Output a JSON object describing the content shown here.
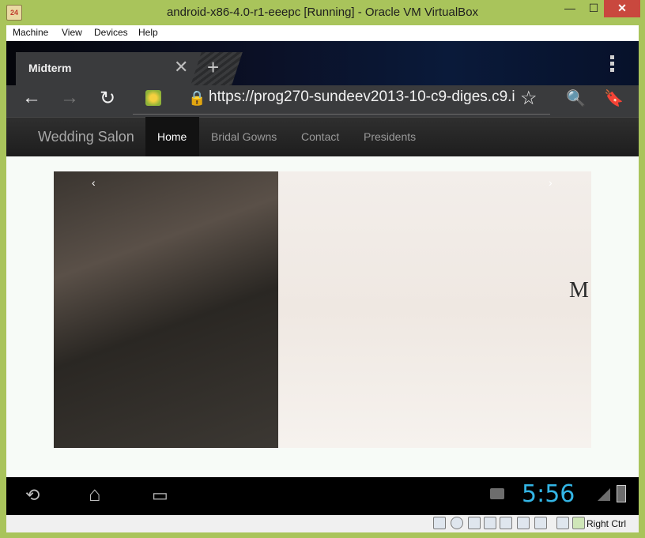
{
  "window": {
    "title": "android-x86-4.0-r1-eeepc [Running] - Oracle VM VirtualBox",
    "app_icon": "virtualbox-icon",
    "controls": {
      "minimize": "—",
      "maximize": "☐",
      "close": "✕"
    }
  },
  "menubar": {
    "items": [
      "Machine",
      "View",
      "Devices",
      "Help"
    ]
  },
  "browser": {
    "tab": {
      "title": "Midterm",
      "close": "✕"
    },
    "new_tab": "+",
    "url": "https://prog270-sundeev2013-10-c9-diges.c9.i",
    "icons": {
      "back": "←",
      "forward": "→",
      "reload": "↻",
      "lock": "🔒",
      "star": "☆",
      "search": "🔍",
      "bookmarks": "🔖"
    }
  },
  "site": {
    "brand": "Wedding Salon",
    "nav": [
      {
        "label": "Home",
        "active": true
      },
      {
        "label": "Bridal Gowns",
        "active": false
      },
      {
        "label": "Contact",
        "active": false
      },
      {
        "label": "Presidents",
        "active": false
      }
    ],
    "carousel": {
      "prev": "‹",
      "next": "›",
      "logo_letter": "M"
    }
  },
  "android": {
    "clock": "5:56",
    "icons": {
      "back": "⟲",
      "home": "⌂",
      "recent": "▭"
    }
  },
  "statusbar": {
    "host_key": "Right Ctrl"
  },
  "colors": {
    "frame": "#a9c45b",
    "clock": "#33b5e5",
    "close": "#c9483e"
  }
}
